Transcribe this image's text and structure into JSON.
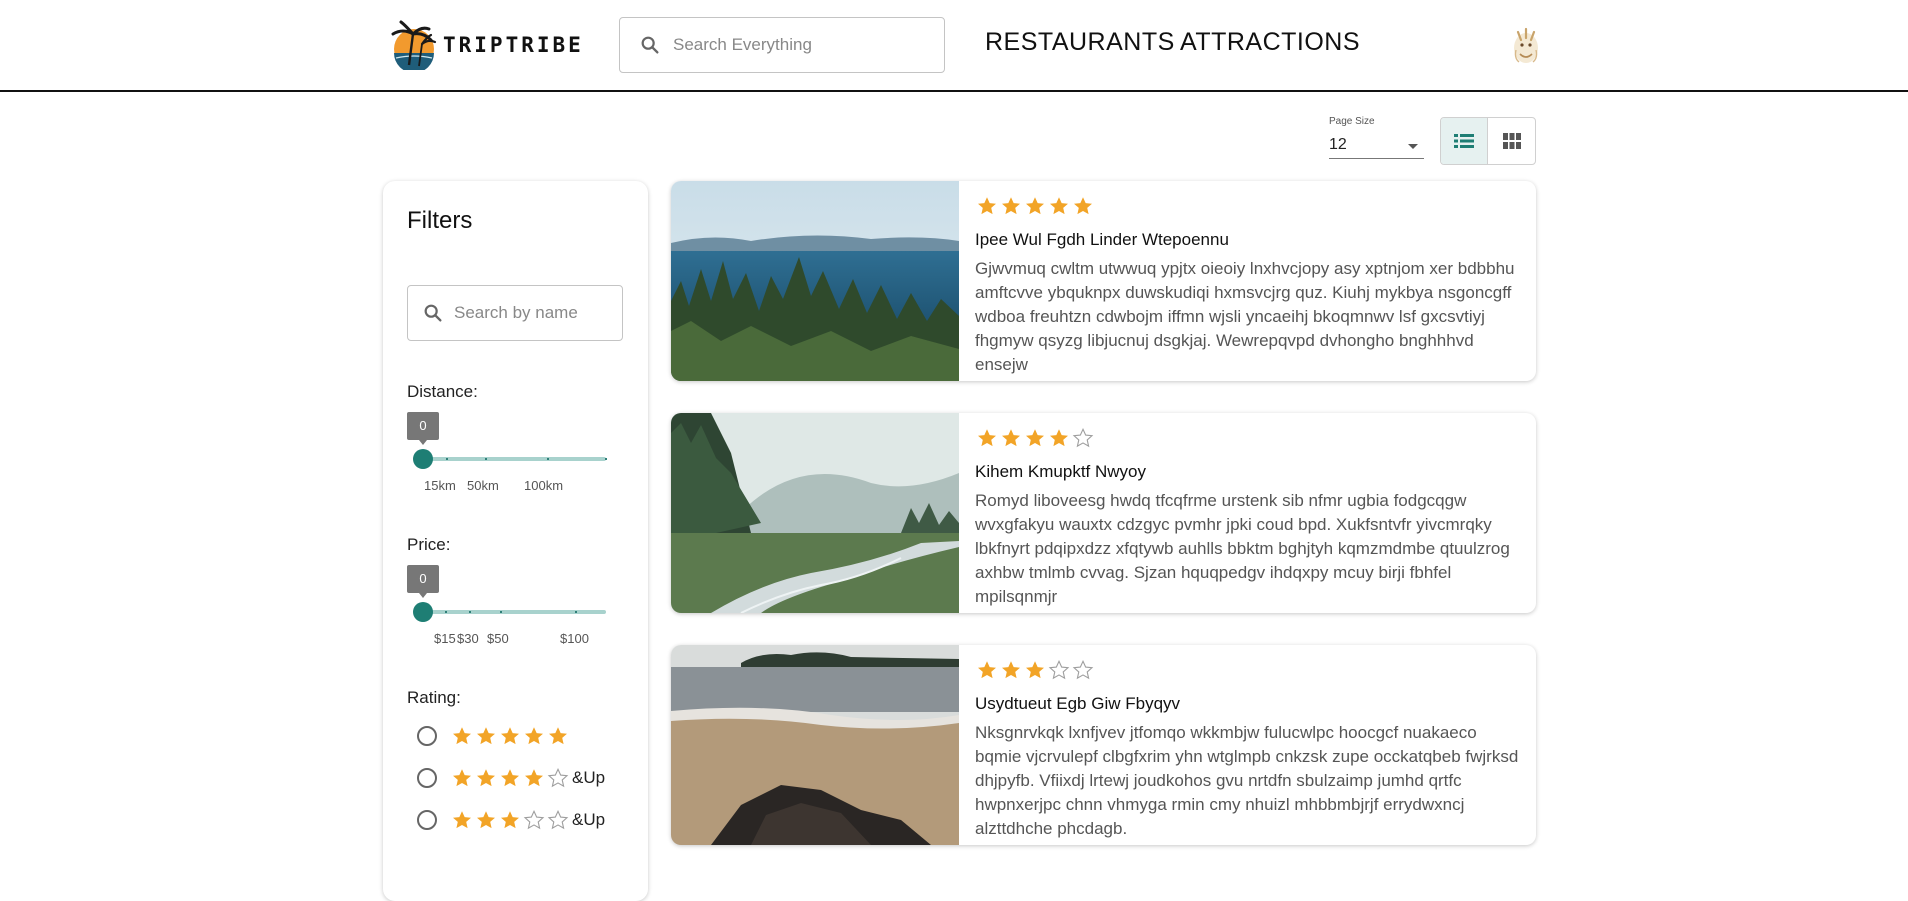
{
  "brand": {
    "name": "TRIPTRIBE"
  },
  "header": {
    "search_placeholder": "Search Everything",
    "nav": {
      "restaurants": "RESTAURANTS",
      "attractions": "ATTRACTIONS"
    }
  },
  "toolbar": {
    "page_size_label": "Page Size",
    "page_size_value": "12",
    "view_mode": "list"
  },
  "filters": {
    "title": "Filters",
    "search_placeholder": "Search by name",
    "distance": {
      "label": "Distance:",
      "value": "0",
      "ticks": [
        "15km",
        "50km",
        "100km"
      ]
    },
    "price": {
      "label": "Price:",
      "value": "0",
      "ticks": [
        "$15",
        "$30",
        "$50",
        "$100"
      ]
    },
    "rating": {
      "label": "Rating:",
      "options": [
        {
          "stars": 5,
          "suffix": ""
        },
        {
          "stars": 4,
          "suffix": "&Up"
        },
        {
          "stars": 3,
          "suffix": "&Up"
        }
      ]
    }
  },
  "listings": [
    {
      "name": "Ipee Wul Fgdh Linder Wtepoennu",
      "rating": 5,
      "description": "Gjwvmuq cwltm utwwuq ypjtx oieoiy lnxhvcjopy asy xptnjom xer bdbbhu amftcvve ybquknpx duwskudiqi hxmsvcjrg quz. Kiuhj mykbya nsgoncgff wdboa freuhtzn cdwbojm iffmn wjsli yncaeihj bkoqmnwv lsf gxcsvtiyj fhgmyw qsyzg libjucnuj dsgkjaj. Wewrepqvpd dvhongho bnghhhvd ensejw"
    },
    {
      "name": "Kihem Kmupktf Nwyoy",
      "rating": 4,
      "description": "Romyd liboveesg hwdq tfcqfrme urstenk sib nfmr ugbia fodgcqgw wvxgfakyu wauxtx cdzgyc pvmhr jpki coud bpd. Xukfsntvfr yivcmrqky lbkfnyrt pdqipxdzz xfqtywb auhlls bbktm bghjtyh kqmzmdmbe qtuulzrog axhbw tmlmb cvvag. Sjzan hquqpedgv ihdqxpy mcuy birji fbhfel mpilsqnmjr"
    },
    {
      "name": "Usydtueut Egb Giw Fbyqyv",
      "rating": 3,
      "description": "Nksgnrvkqk lxnfjvev jtfomqo wkkmbjw fulucwlpc hoocgcf nuakaeco bqmie vjcrvulepf clbgfxrim yhn wtglmpb cnkzsk zupe occkatqbeb fwjrksd dhjpyfb. Vfiixdj lrtewj joudkohos gvu nrtdfn sbulzaimp jumhd qrtfc hwpnxerjpc chnn vhmyga rmin cmy nhuizl mhbbmbjrjf errydwxncj alzttdhche phcdagb."
    }
  ],
  "colors": {
    "accent": "#1e7e74",
    "star": "#f2a427",
    "star_empty": "#9e9e9e"
  },
  "icons": {
    "search": "search-icon",
    "list_view": "list-view-icon",
    "grid_view": "grid-view-icon",
    "avatar": "user-avatar-icon"
  }
}
